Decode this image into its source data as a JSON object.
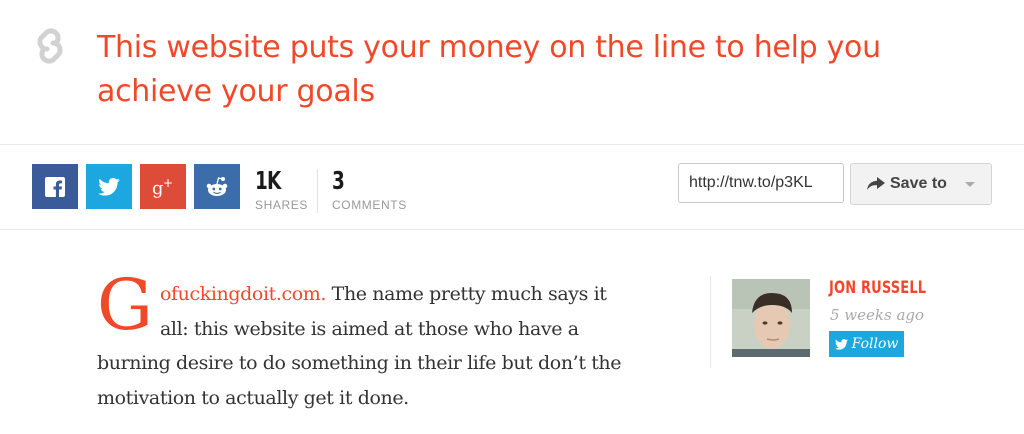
{
  "header": {
    "title": "This website puts your money on the line to help you achieve your goals"
  },
  "share": {
    "shares_count": "1K",
    "shares_label": "SHARES",
    "comments_count": "3",
    "comments_label": "COMMENTS",
    "short_url": "http://tnw.to/p3KL",
    "save_label": "Save to"
  },
  "article": {
    "dropcap": "G",
    "link_text": "ofuckingdoit.com.",
    "line1_rest": " The name pretty much says it",
    "line2": "all: this website is aimed at those who have a",
    "line3": "burning desire to do something in their life but don’t the",
    "line4": "motivation to actually get it done."
  },
  "author": {
    "name": "JON RUSSELL",
    "time": "5 weeks ago",
    "follow_label": "Follow"
  },
  "colors": {
    "accent": "#f0492a",
    "facebook": "#3b5a9a",
    "twitter": "#1da7e0",
    "googleplus": "#dd4b39",
    "reddit": "#3b6daa"
  }
}
